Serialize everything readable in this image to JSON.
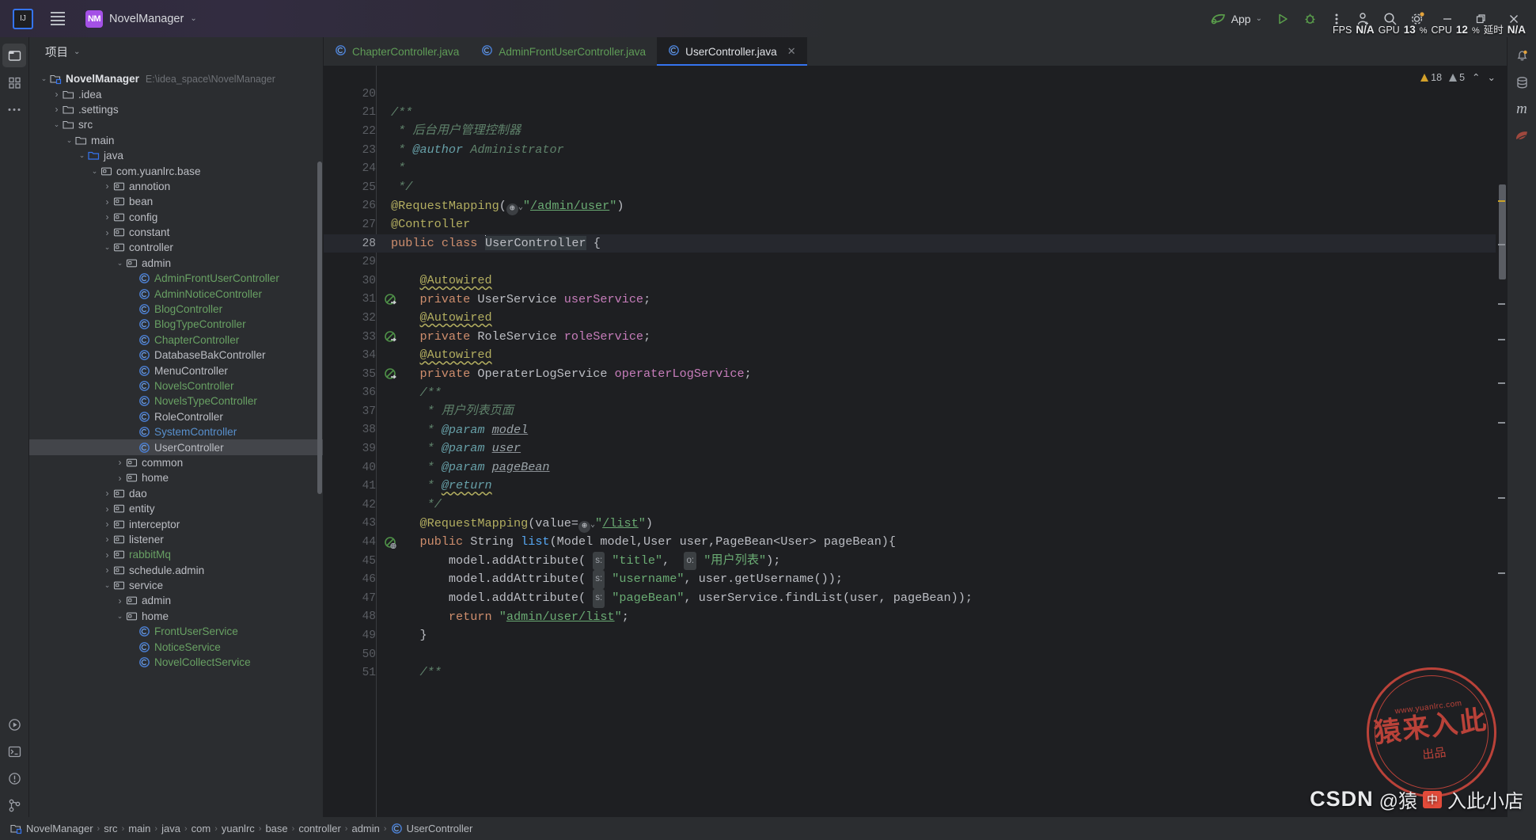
{
  "titlebar": {
    "logo_text": "IJ",
    "project_badge": "NM",
    "project_name": "NovelManager",
    "chevron": "⌄",
    "run_config": "App",
    "run_chevron": "⌄"
  },
  "perf": {
    "fps_label": "FPS",
    "fps_value": "N/A",
    "gpu_label": "GPU",
    "gpu_value": "13",
    "gpu_unit": "%",
    "cpu_label": "CPU",
    "cpu_value": "12",
    "cpu_unit": "%",
    "latency_label": "延时",
    "latency_value": "N/A"
  },
  "project_panel": {
    "title": "项目",
    "title_chevron": "⌄",
    "tree": [
      {
        "depth": 0,
        "arrow": "open",
        "icon": "module",
        "label": "NovelManager",
        "style": "bold",
        "hint": "E:\\idea_space\\NovelManager"
      },
      {
        "depth": 1,
        "arrow": "closed",
        "icon": "folder",
        "label": ".idea",
        "style": "plain",
        "hint": ""
      },
      {
        "depth": 1,
        "arrow": "closed",
        "icon": "folder",
        "label": ".settings",
        "style": "plain",
        "hint": ""
      },
      {
        "depth": 1,
        "arrow": "open",
        "icon": "folder",
        "label": "src",
        "style": "plain",
        "hint": ""
      },
      {
        "depth": 2,
        "arrow": "open",
        "icon": "folder",
        "label": "main",
        "style": "plain",
        "hint": ""
      },
      {
        "depth": 3,
        "arrow": "open",
        "icon": "source",
        "label": "java",
        "style": "plain",
        "hint": ""
      },
      {
        "depth": 4,
        "arrow": "open",
        "icon": "package",
        "label": "com.yuanlrc.base",
        "style": "plain",
        "hint": ""
      },
      {
        "depth": 5,
        "arrow": "closed",
        "icon": "package",
        "label": "annotion",
        "style": "plain",
        "hint": ""
      },
      {
        "depth": 5,
        "arrow": "closed",
        "icon": "package",
        "label": "bean",
        "style": "plain",
        "hint": ""
      },
      {
        "depth": 5,
        "arrow": "closed",
        "icon": "package",
        "label": "config",
        "style": "plain",
        "hint": ""
      },
      {
        "depth": 5,
        "arrow": "closed",
        "icon": "package",
        "label": "constant",
        "style": "plain",
        "hint": ""
      },
      {
        "depth": 5,
        "arrow": "open",
        "icon": "package",
        "label": "controller",
        "style": "plain",
        "hint": ""
      },
      {
        "depth": 6,
        "arrow": "open",
        "icon": "package",
        "label": "admin",
        "style": "plain",
        "hint": ""
      },
      {
        "depth": 7,
        "arrow": "none",
        "icon": "class",
        "label": "AdminFrontUserController",
        "style": "green",
        "hint": ""
      },
      {
        "depth": 7,
        "arrow": "none",
        "icon": "class",
        "label": "AdminNoticeController",
        "style": "green",
        "hint": ""
      },
      {
        "depth": 7,
        "arrow": "none",
        "icon": "class",
        "label": "BlogController",
        "style": "green",
        "hint": ""
      },
      {
        "depth": 7,
        "arrow": "none",
        "icon": "class",
        "label": "BlogTypeController",
        "style": "green",
        "hint": ""
      },
      {
        "depth": 7,
        "arrow": "none",
        "icon": "class",
        "label": "ChapterController",
        "style": "green",
        "hint": ""
      },
      {
        "depth": 7,
        "arrow": "none",
        "icon": "class",
        "label": "DatabaseBakController",
        "style": "plain",
        "hint": ""
      },
      {
        "depth": 7,
        "arrow": "none",
        "icon": "class",
        "label": "MenuController",
        "style": "plain",
        "hint": ""
      },
      {
        "depth": 7,
        "arrow": "none",
        "icon": "class",
        "label": "NovelsController",
        "style": "green",
        "hint": ""
      },
      {
        "depth": 7,
        "arrow": "none",
        "icon": "class",
        "label": "NovelsTypeController",
        "style": "green",
        "hint": ""
      },
      {
        "depth": 7,
        "arrow": "none",
        "icon": "class",
        "label": "RoleController",
        "style": "plain",
        "hint": ""
      },
      {
        "depth": 7,
        "arrow": "none",
        "icon": "class",
        "label": "SystemController",
        "style": "blue",
        "hint": ""
      },
      {
        "depth": 7,
        "arrow": "none",
        "icon": "class",
        "label": "UserController",
        "style": "plain",
        "hint": "",
        "selected": true
      },
      {
        "depth": 6,
        "arrow": "closed",
        "icon": "package",
        "label": "common",
        "style": "plain",
        "hint": ""
      },
      {
        "depth": 6,
        "arrow": "closed",
        "icon": "package",
        "label": "home",
        "style": "plain",
        "hint": ""
      },
      {
        "depth": 5,
        "arrow": "closed",
        "icon": "package",
        "label": "dao",
        "style": "plain",
        "hint": ""
      },
      {
        "depth": 5,
        "arrow": "closed",
        "icon": "package",
        "label": "entity",
        "style": "plain",
        "hint": ""
      },
      {
        "depth": 5,
        "arrow": "closed",
        "icon": "package",
        "label": "interceptor",
        "style": "plain",
        "hint": ""
      },
      {
        "depth": 5,
        "arrow": "closed",
        "icon": "package",
        "label": "listener",
        "style": "plain",
        "hint": ""
      },
      {
        "depth": 5,
        "arrow": "closed",
        "icon": "package",
        "label": "rabbitMq",
        "style": "green",
        "hint": ""
      },
      {
        "depth": 5,
        "arrow": "closed",
        "icon": "package",
        "label": "schedule.admin",
        "style": "plain",
        "hint": ""
      },
      {
        "depth": 5,
        "arrow": "open",
        "icon": "package",
        "label": "service",
        "style": "plain",
        "hint": ""
      },
      {
        "depth": 6,
        "arrow": "closed",
        "icon": "package",
        "label": "admin",
        "style": "plain",
        "hint": ""
      },
      {
        "depth": 6,
        "arrow": "open",
        "icon": "package",
        "label": "home",
        "style": "plain",
        "hint": ""
      },
      {
        "depth": 7,
        "arrow": "none",
        "icon": "class",
        "label": "FrontUserService",
        "style": "green",
        "hint": ""
      },
      {
        "depth": 7,
        "arrow": "none",
        "icon": "class",
        "label": "NoticeService",
        "style": "green",
        "hint": ""
      },
      {
        "depth": 7,
        "arrow": "none",
        "icon": "class",
        "label": "NovelCollectService",
        "style": "green",
        "hint": ""
      }
    ]
  },
  "editor": {
    "tabs": [
      {
        "label": "ChapterController.java",
        "color": "green",
        "active": false,
        "closable": false
      },
      {
        "label": "AdminFrontUserController.java",
        "color": "green",
        "active": false,
        "closable": false
      },
      {
        "label": "UserController.java",
        "color": "plain",
        "active": true,
        "closable": true,
        "close_glyph": "✕"
      }
    ],
    "inspection": {
      "warning_count": "18",
      "weak_count": "5",
      "up_glyph": "⌃",
      "down_glyph": "⌄"
    },
    "first_line_number": 20,
    "current_line": 28,
    "lines": [
      {
        "n": 20,
        "html": ""
      },
      {
        "n": 21,
        "html": "<span class='cmt'>/**</span>"
      },
      {
        "n": 22,
        "html": "<span class='cmt'> * 后台用户管理控制器</span>"
      },
      {
        "n": 23,
        "html": "<span class='cmt'> * </span><span class='cmt-tag'>@author</span><span class='cmt'> Administrator</span>"
      },
      {
        "n": 24,
        "html": "<span class='cmt'> *</span>"
      },
      {
        "n": 25,
        "html": "<span class='cmt'> */</span>"
      },
      {
        "n": 26,
        "html": "<span class='ann'>@RequestMapping</span><span class='pln'>(</span><span class='globe'>⊕</span><span class='globechev'>⌄</span><span class='str'>\"</span><span class='strlink'>/admin/user</span><span class='str'>\"</span><span class='pln'>)</span>"
      },
      {
        "n": 27,
        "html": "<span class='ann'>@Controller</span>"
      },
      {
        "n": 28,
        "html": "<span class='kw'>public</span> <span class='kw'>class</span> <span class='caret'></span><span class='idhl typ'>UserController</span> <span class='pln'>{</span>",
        "current": true,
        "gutter_icon": "bean"
      },
      {
        "n": 29,
        "html": ""
      },
      {
        "n": 30,
        "html": "    <span class='ann wavy'>@Autowired</span>"
      },
      {
        "n": 31,
        "html": "    <span class='kw'>private</span> <span class='typ'>UserService</span> <span class='fld'>userService</span><span class='pln'>;</span>",
        "gutter_icon": "inject"
      },
      {
        "n": 32,
        "html": "    <span class='ann wavy'>@Autowired</span>"
      },
      {
        "n": 33,
        "html": "    <span class='kw'>private</span> <span class='typ'>RoleService</span> <span class='fld'>roleService</span><span class='pln'>;</span>",
        "gutter_icon": "inject"
      },
      {
        "n": 34,
        "html": "    <span class='ann wavy'>@Autowired</span>"
      },
      {
        "n": 35,
        "html": "    <span class='kw'>private</span> <span class='typ'>OperaterLogService</span> <span class='fld'>operaterLogService</span><span class='pln'>;</span>",
        "gutter_icon": "inject"
      },
      {
        "n": 36,
        "html": "    <span class='cmt'>/**</span>"
      },
      {
        "n": 37,
        "html": "     <span class='cmt'>* 用户列表页面</span>"
      },
      {
        "n": 38,
        "html": "     <span class='cmt'>* </span><span class='cmt-tag'>@param</span> <span class='cmtp'>model</span>"
      },
      {
        "n": 39,
        "html": "     <span class='cmt'>* </span><span class='cmt-tag'>@param</span> <span class='cmtp'>user</span>"
      },
      {
        "n": 40,
        "html": "     <span class='cmt'>* </span><span class='cmt-tag'>@param</span> <span class='cmtp'>pageBean</span>"
      },
      {
        "n": 41,
        "html": "     <span class='cmt'>* </span><span class='cmt-tag wavy'>@return</span>"
      },
      {
        "n": 42,
        "html": "     <span class='cmt'>*/</span>"
      },
      {
        "n": 43,
        "html": "    <span class='ann'>@RequestMapping</span><span class='pln'>(value=</span><span class='globe'>⊕</span><span class='globechev'>⌄</span><span class='str'>\"</span><span class='strlink'>/list</span><span class='str'>\"</span><span class='pln'>)</span>"
      },
      {
        "n": 44,
        "html": "    <span class='kw'>public</span> <span class='typ'>String</span> <span class='mth'>list</span><span class='pln'>(Model model,User user,PageBean&lt;User&gt; pageBean){</span>",
        "gutter_icon": "web"
      },
      {
        "n": 45,
        "html": "        <span class='pln'>model.addAttribute(</span> <span class='phint'>s:</span> <span class='str'>\"title\"</span><span class='pln'>,</span>  <span class='phint'>o:</span> <span class='str'>\"用户列表\"</span><span class='pln'>);</span>"
      },
      {
        "n": 46,
        "html": "        <span class='pln'>model.addAttribute(</span> <span class='phint'>s:</span> <span class='str'>\"username\"</span><span class='pln'>, user.getUsername());</span>"
      },
      {
        "n": 47,
        "html": "        <span class='pln'>model.addAttribute(</span> <span class='phint'>s:</span> <span class='str'>\"pageBean\"</span><span class='pln'>, userService.findList(user, pageBean));</span>"
      },
      {
        "n": 48,
        "html": "        <span class='kw'>return</span> <span class='str'>\"</span><span class='strlink'>admin/user/list</span><span class='str'>\"</span><span class='pln'>;</span>"
      },
      {
        "n": 49,
        "html": "    <span class='pln'>}</span>"
      },
      {
        "n": 50,
        "html": ""
      },
      {
        "n": 51,
        "html": "    <span class='cmt'>/**</span>"
      }
    ]
  },
  "status_bar": {
    "crumbs": [
      {
        "icon": "module",
        "label": "NovelManager"
      },
      {
        "icon": "none",
        "label": "src"
      },
      {
        "icon": "none",
        "label": "main"
      },
      {
        "icon": "none",
        "label": "java"
      },
      {
        "icon": "none",
        "label": "com"
      },
      {
        "icon": "none",
        "label": "yuanlrc"
      },
      {
        "icon": "none",
        "label": "base"
      },
      {
        "icon": "none",
        "label": "controller"
      },
      {
        "icon": "none",
        "label": "admin"
      },
      {
        "icon": "class",
        "label": "UserController"
      }
    ],
    "separator": "›"
  },
  "watermark": {
    "stamp_top": "www.yuanlrc.com",
    "stamp_big": "猿来入此",
    "stamp_bottom": "出品",
    "csdn_brand": "CSDN",
    "csdn_at": "@猿",
    "csdn_tag": "中",
    "csdn_user": "入此小店"
  },
  "colors": {
    "accent": "#3574f0",
    "brand_purple": "#a451e6",
    "warning": "#d4a12a",
    "green_file": "#68a063",
    "stamp_red": "#c8453b"
  }
}
